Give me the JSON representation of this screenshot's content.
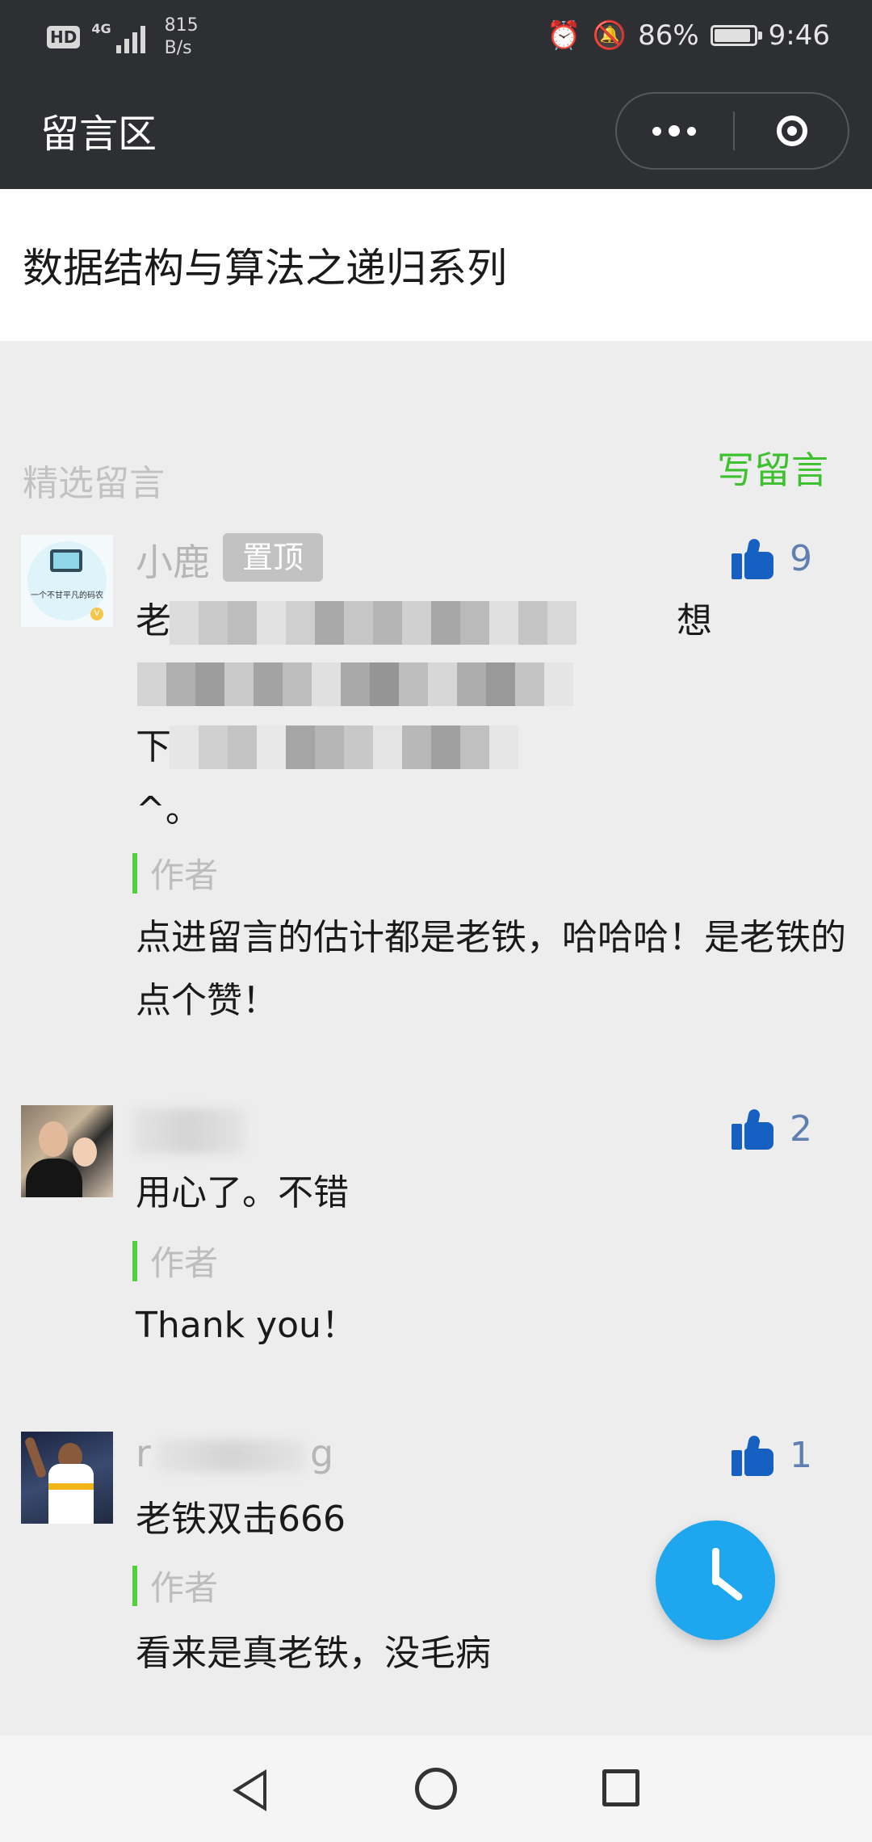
{
  "status_bar": {
    "hd": "HD",
    "network": "4G",
    "speed": "815",
    "speed_unit": "B/s",
    "battery": "86%",
    "battery_level": 0.86,
    "time": "9:46"
  },
  "nav": {
    "title": "留言区"
  },
  "article": {
    "title": "数据结构与算法之递归系列"
  },
  "section": {
    "label": "精选留言",
    "write_label": "写留言"
  },
  "comments": [
    {
      "name": "小鹿",
      "badge": "置顶",
      "likes": "9",
      "line1_start": "老",
      "line1_end": "想",
      "line3_start": "下",
      "line4": "^。",
      "author_label": "作者",
      "reply": "点进留言的估计都是老铁，哈哈哈！是老铁的点个赞！"
    },
    {
      "likes": "2",
      "text": "用心了。不错",
      "author_label": "作者",
      "reply": "Thank you！"
    },
    {
      "name_start": "r",
      "name_end": "g",
      "likes": "1",
      "text": "老铁双击666",
      "author_label": "作者",
      "reply": "看来是真老铁，没毛病"
    }
  ]
}
